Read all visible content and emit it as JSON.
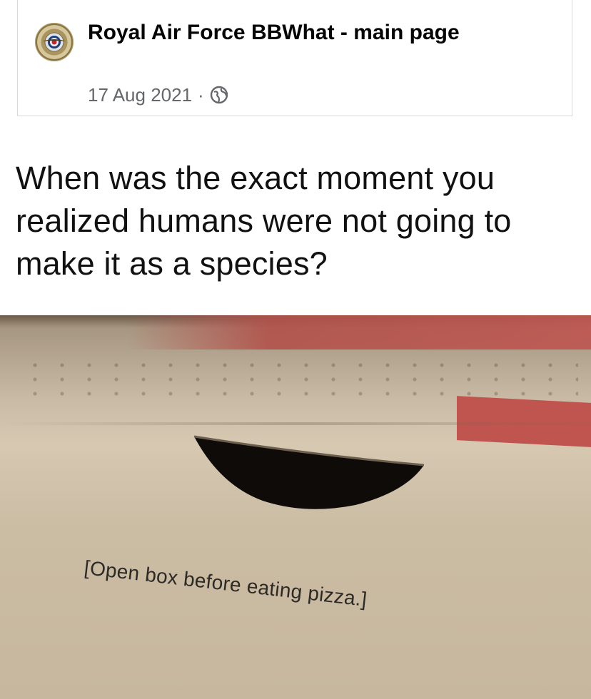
{
  "post": {
    "page_name": "Royal Air Force BBWhat - main page",
    "date": "17 Aug 2021",
    "separator": "·",
    "audience_icon": "globe-icon"
  },
  "meme": {
    "caption": "When was the exact moment you realized humans were not going to make it as a species?",
    "box_print": "[Open box before eating pizza.]"
  },
  "colors": {
    "name_text": "#050505",
    "meta_text": "#65676b",
    "cardboard": "#cbbca4",
    "box_red": "#c0544f"
  }
}
